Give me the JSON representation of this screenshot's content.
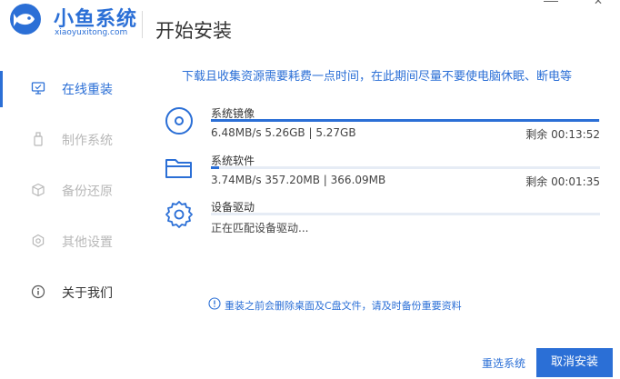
{
  "header": {
    "brand_name": "小鱼系统",
    "brand_url": "xiaoyuxitong.com",
    "page_title": "开始安装"
  },
  "sidebar": {
    "items": [
      {
        "label": "在线重装",
        "icon": "monitor-icon",
        "state": "active"
      },
      {
        "label": "制作系统",
        "icon": "usb-icon",
        "state": "disabled"
      },
      {
        "label": "备份还原",
        "icon": "backup-icon",
        "state": "disabled"
      },
      {
        "label": "其他设置",
        "icon": "settings-icon",
        "state": "disabled"
      },
      {
        "label": "关于我们",
        "icon": "info-icon",
        "state": "normal"
      }
    ]
  },
  "main": {
    "info_line": "下载且收集资源需要耗费一点时间，在此期间尽量不要使电脑休眠、断电等",
    "tasks": [
      {
        "name": "系统镜像",
        "icon": "disc-icon",
        "speed": "6.48MB/s 5.26GB | 5.27GB",
        "remaining": "剩余 00:13:52",
        "progress": 0.998
      },
      {
        "name": "系统软件",
        "icon": "folder-icon",
        "speed": "3.74MB/s 357.20MB | 366.09MB",
        "remaining": "剩余 00:01:35",
        "progress": 0.02
      },
      {
        "name": "设备驱动",
        "icon": "gear-icon",
        "speed": "正在匹配设备驱动...",
        "remaining": "",
        "progress": 0
      }
    ],
    "warning": "重装之前会删除桌面及C盘文件，请及时备份重要资料"
  },
  "footer": {
    "reselect_label": "重选系统",
    "cancel_label": "取消安装"
  },
  "colors": {
    "accent": "#2b6fd6",
    "track": "#e6ecf5",
    "disabled_text": "#b8b8b8"
  }
}
